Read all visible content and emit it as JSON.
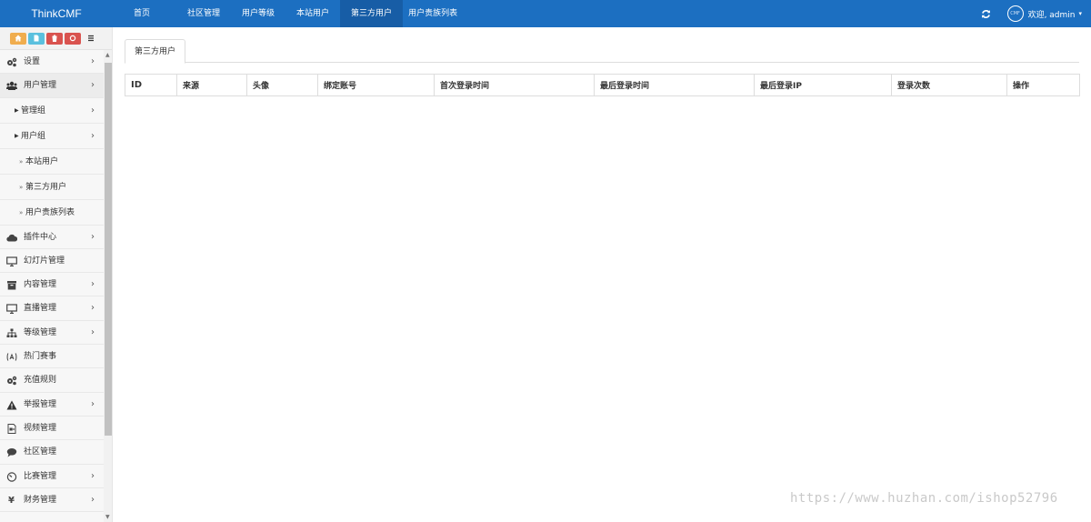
{
  "brand": "ThinkCMF",
  "nav": [
    {
      "label": "首页",
      "active": false
    },
    {
      "label": "社区管理",
      "active": false
    },
    {
      "label": "用户等级",
      "active": false
    },
    {
      "label": "本站用户",
      "active": false
    },
    {
      "label": "第三方用户",
      "active": true
    },
    {
      "label": "用户贵族列表",
      "active": false
    }
  ],
  "user": {
    "welcome": "欢迎, admin",
    "caret": "▾",
    "avatar_text": "CMF"
  },
  "shortcuts": [
    {
      "icon": "home-icon",
      "color": "#f0ad4e"
    },
    {
      "icon": "file-icon",
      "color": "#5bc0de"
    },
    {
      "icon": "trash-icon",
      "color": "#d9534f"
    },
    {
      "icon": "recycle-icon",
      "color": "#d9534f"
    },
    {
      "icon": "list-icon",
      "color": "#f2f2f2"
    }
  ],
  "sidebar": [
    {
      "label": "设置",
      "icon": "gears-icon",
      "arrow": "›",
      "type": "top"
    },
    {
      "label": "用户管理",
      "icon": "users-icon",
      "arrow": "›",
      "type": "top",
      "open": true
    },
    {
      "label": "管理组",
      "arrow": "›",
      "type": "sub"
    },
    {
      "label": "用户组",
      "arrow": "›",
      "type": "sub"
    },
    {
      "label": "本站用户",
      "type": "leaf"
    },
    {
      "label": "第三方用户",
      "type": "leaf"
    },
    {
      "label": "用户贵族列表",
      "type": "leaf"
    },
    {
      "label": "插件中心",
      "icon": "cloud-icon",
      "arrow": "›",
      "type": "top"
    },
    {
      "label": "幻灯片管理",
      "icon": "monitor-icon",
      "type": "top"
    },
    {
      "label": "内容管理",
      "icon": "archive-icon",
      "arrow": "›",
      "type": "top"
    },
    {
      "label": "直播管理",
      "icon": "monitor-icon",
      "arrow": "›",
      "type": "top"
    },
    {
      "label": "等级管理",
      "icon": "sitemap-icon",
      "arrow": "›",
      "type": "top"
    },
    {
      "label": "热门赛事",
      "icon": "trophy-icon",
      "type": "top"
    },
    {
      "label": "充值规则",
      "icon": "gears-icon",
      "type": "top"
    },
    {
      "label": "举报管理",
      "icon": "warning-icon",
      "arrow": "›",
      "type": "top"
    },
    {
      "label": "视频管理",
      "icon": "video-file-icon",
      "type": "top"
    },
    {
      "label": "社区管理",
      "icon": "comment-icon",
      "type": "top"
    },
    {
      "label": "比赛管理",
      "icon": "dashboard-icon",
      "arrow": "›",
      "type": "top"
    },
    {
      "label": "财务管理",
      "icon": "yen-icon",
      "arrow": "›",
      "type": "top"
    }
  ],
  "tab": "第三方用户",
  "table": {
    "columns": [
      "ID",
      "来源",
      "头像",
      "绑定账号",
      "首次登录时间",
      "最后登录时间",
      "最后登录IP",
      "登录次数",
      "操作"
    ]
  },
  "watermark": "https://www.huzhan.com/ishop52796"
}
